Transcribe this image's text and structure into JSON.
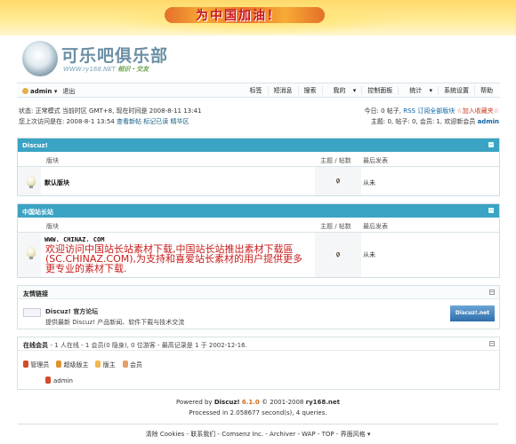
{
  "banner": {
    "slogan": "为中国加油！"
  },
  "logo": {
    "name": "可乐吧俱乐部",
    "url": "WWW.ry168.NET",
    "tagline": "相识・交友"
  },
  "toolbar": {
    "user": "admin",
    "logout": "退出",
    "nav": [
      "短消息",
      "搜索",
      "我的",
      "控制面板",
      "统计",
      "系统设置",
      "帮助"
    ],
    "first": "标签"
  },
  "status": {
    "line1": "状态: 正常模式 当前时区 GMT+8, 现在时间是 2008-8-11 13:41",
    "line2": "您上次访问是在: 2008-8-1 13:54",
    "link_new": "查看新帖",
    "link_read": "标记已读",
    "link_digest": "精华区",
    "today": "今日: 0 帖子,",
    "rss": "RSS 订阅全部版块",
    "fav": "☆加入收藏夹☆",
    "stats": "主题: 0, 帖子: 0, 会员: 1, 欢迎新会员",
    "newuser": "admin"
  },
  "cat1": {
    "title": "Discuz!",
    "h_forum": "版块",
    "h_count": "主题 / 帖数",
    "h_last": "最后发表",
    "forum": "默认版块",
    "t": "0",
    "p": "0",
    "last": "从未"
  },
  "cat2": {
    "title": "中国站长站",
    "h_forum": "版块",
    "h_count": "主题 / 帖数",
    "h_last": "最后发表",
    "forum": "WWW. CHINAZ. COM",
    "desc": "欢迎访问中国站长站素材下载,中国站长站推出素材下载區(SC.CHINAZ.COM),为支持和喜爱站长素材的用户提供更多更专业的素材下载.",
    "t": "0",
    "p": "0",
    "last": "从未"
  },
  "links": {
    "title": "友情链接",
    "name": "Discuz! 官方论坛",
    "desc": "提供最新 Discuz! 产品新闻、软件下载与技术交流",
    "badge": "Discuz!.net"
  },
  "online": {
    "title": "在线会员",
    "summary": "- 1 人在线 - 1 会员(0 隐身), 0 位游客 - 最高记录是 1 于 2002-12-16.",
    "legend": [
      "管理员",
      "超级版主",
      "版主",
      "会员"
    ],
    "user": "admin"
  },
  "footer": {
    "powered": "Powered by",
    "brand": "Discuz!",
    "ver": "6.1.0",
    "copy": "© 2001-2008",
    "site": "ry168.net",
    "processed": "Processed in 2.058677 second(s), 4 queries.",
    "links": "清除 Cookies - 联系我们 - Comsenz Inc. - Archiver - WAP - TOP - 界面风格"
  },
  "colors": {
    "accent": "#3ba3c3",
    "link": "#145e85",
    "highlight": "#c81b1b"
  }
}
